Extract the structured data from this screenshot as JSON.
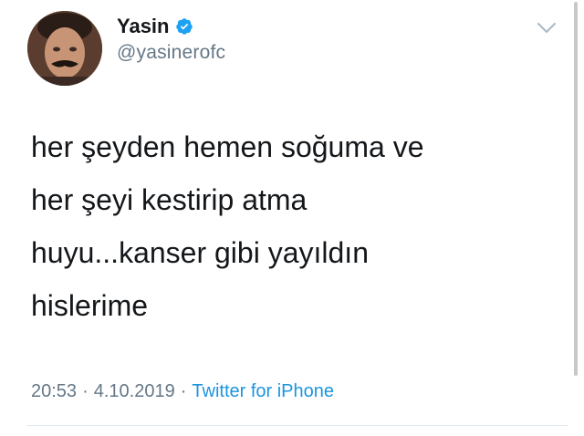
{
  "tweet": {
    "author": {
      "display_name": "Yasin",
      "handle": "@yasinerofc",
      "verified_icon": "verified-badge-icon",
      "avatar_icon": "avatar"
    },
    "text_lines": [
      "her şeyden hemen soğuma ve",
      "her şeyi kestirip atma",
      "huyu...kanser gibi yayıldın",
      "hislerime"
    ],
    "meta": {
      "time": "20:53",
      "separator": "·",
      "date": "4.10.2019",
      "source": "Twitter for iPhone"
    },
    "menu_icon": "chevron-down-icon"
  },
  "colors": {
    "text": "#14171a",
    "secondary": "#657786",
    "link": "#1b95e0",
    "verified": "#1da1f2",
    "divider": "#e1e8ed"
  }
}
